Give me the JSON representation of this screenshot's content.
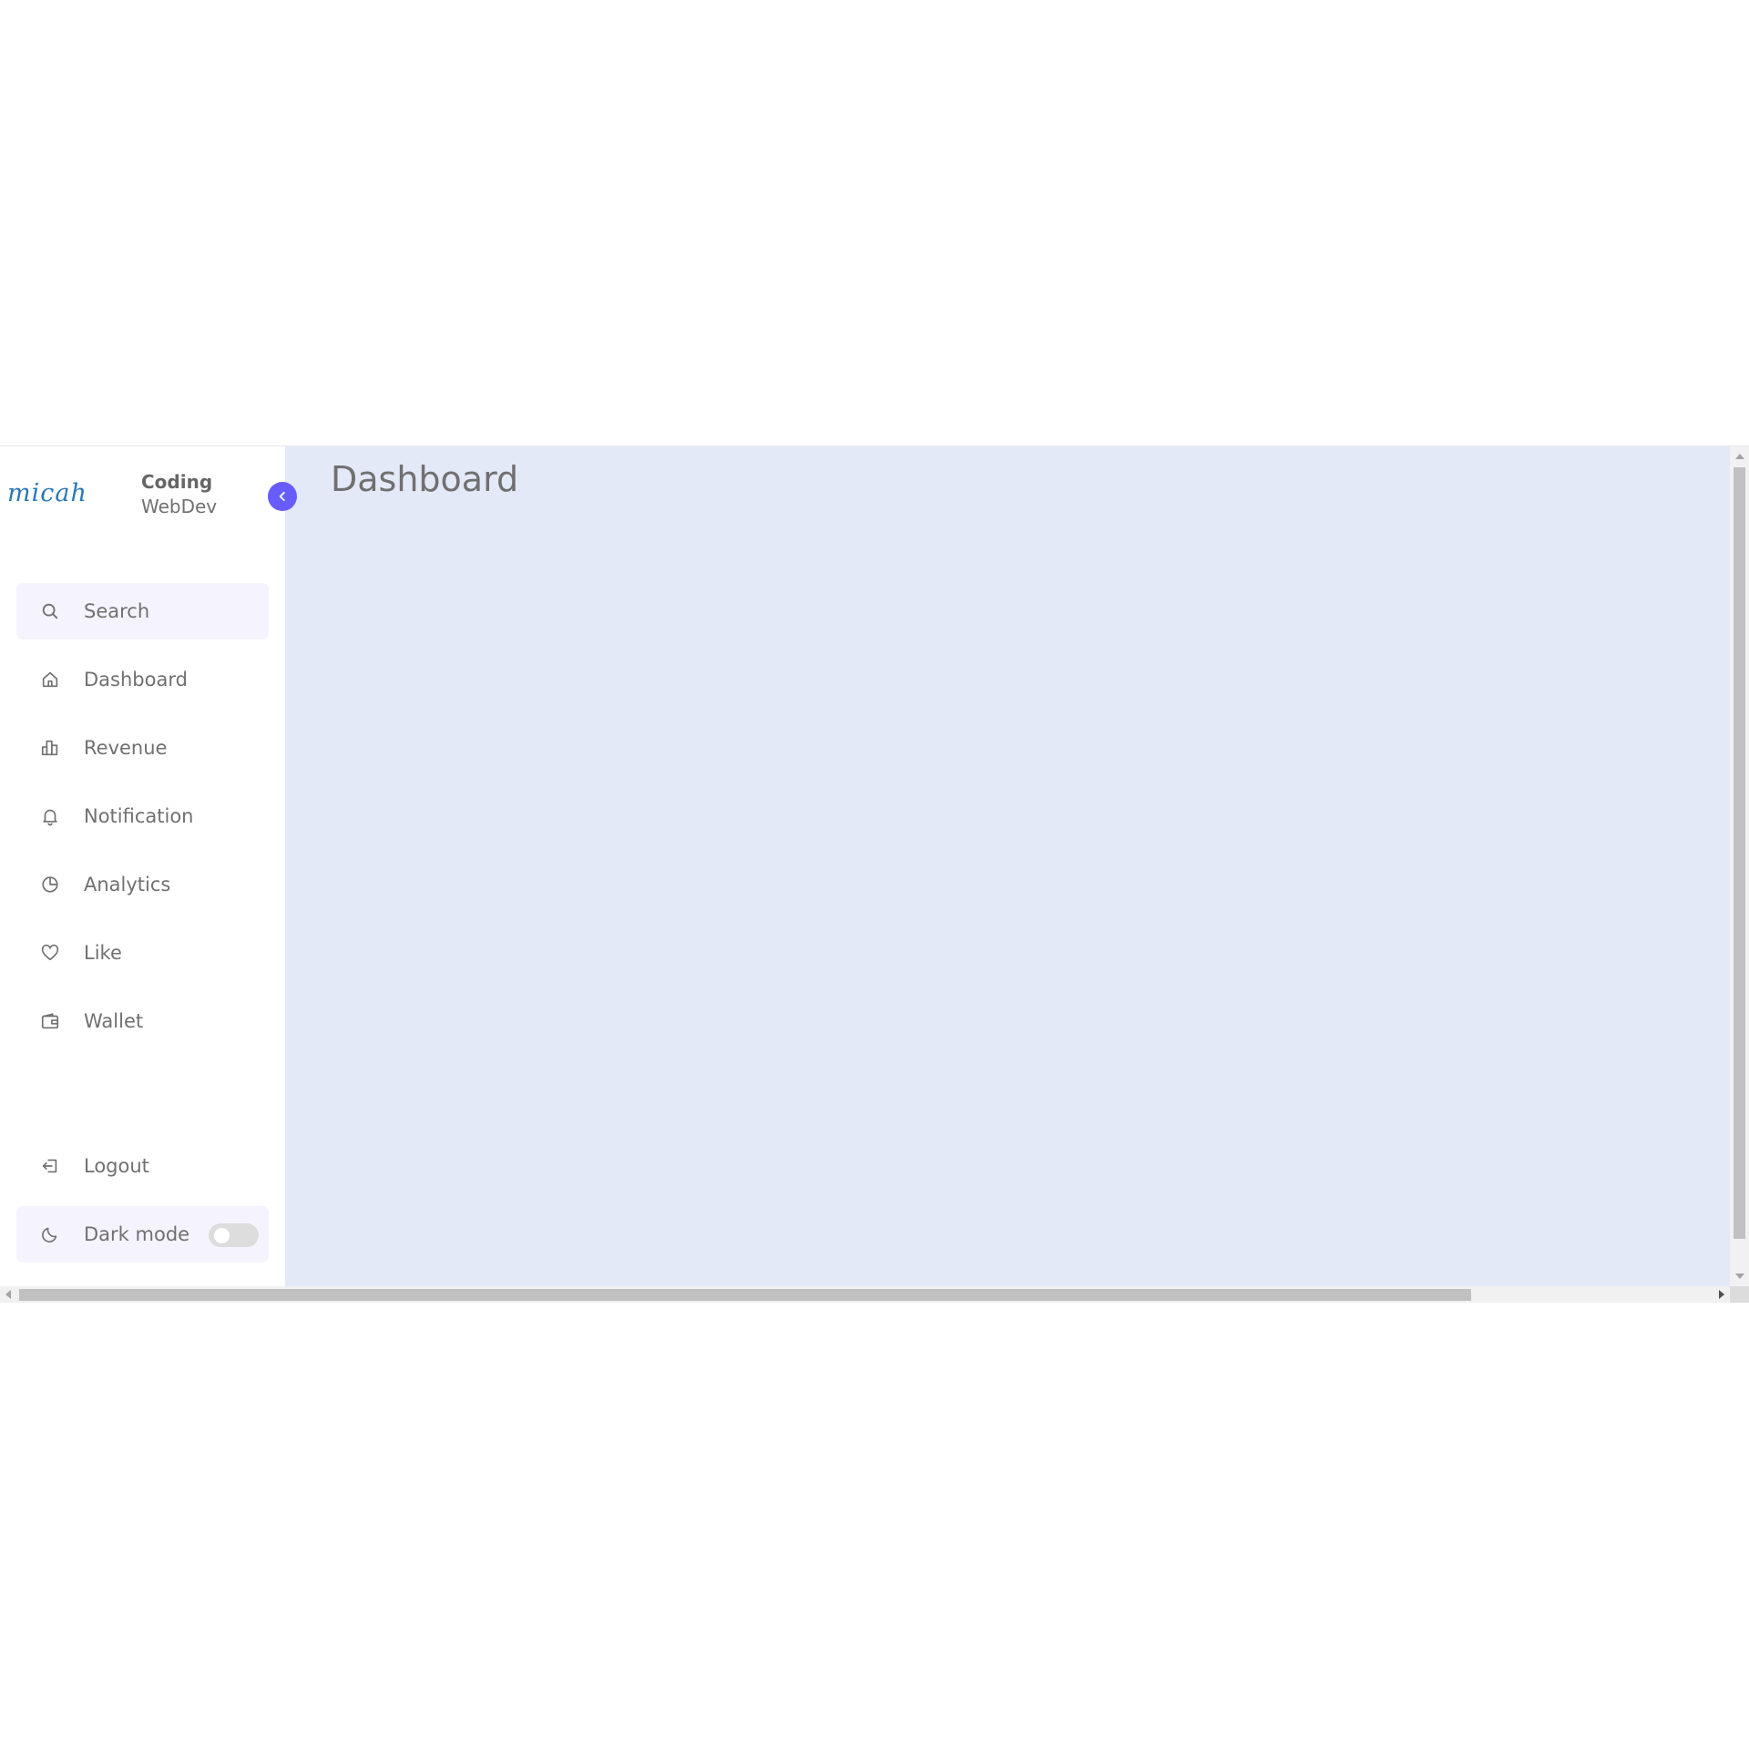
{
  "brand": {
    "logo_text": "micah",
    "name_line1": "Coding",
    "name_line2": "WebDev"
  },
  "sidebar": {
    "search": {
      "label": "Search",
      "icon": "search-icon"
    },
    "items": [
      {
        "label": "Dashboard",
        "icon": "home-icon"
      },
      {
        "label": "Revenue",
        "icon": "bar-chart-icon"
      },
      {
        "label": "Notification",
        "icon": "bell-icon"
      },
      {
        "label": "Analytics",
        "icon": "pie-chart-icon"
      },
      {
        "label": "Like",
        "icon": "heart-icon"
      },
      {
        "label": "Wallet",
        "icon": "wallet-icon"
      }
    ],
    "logout": {
      "label": "Logout",
      "icon": "logout-icon"
    },
    "dark_mode": {
      "label": "Dark mode",
      "icon": "moon-icon",
      "enabled": false
    }
  },
  "main": {
    "title": "Dashboard"
  },
  "colors": {
    "accent": "#695cfe",
    "main_bg": "#e4e9f7",
    "sidebar_bg": "#ffffff",
    "highlight_bg": "#f5f4fe",
    "text": "#707070",
    "logo": "#2a77b8"
  }
}
